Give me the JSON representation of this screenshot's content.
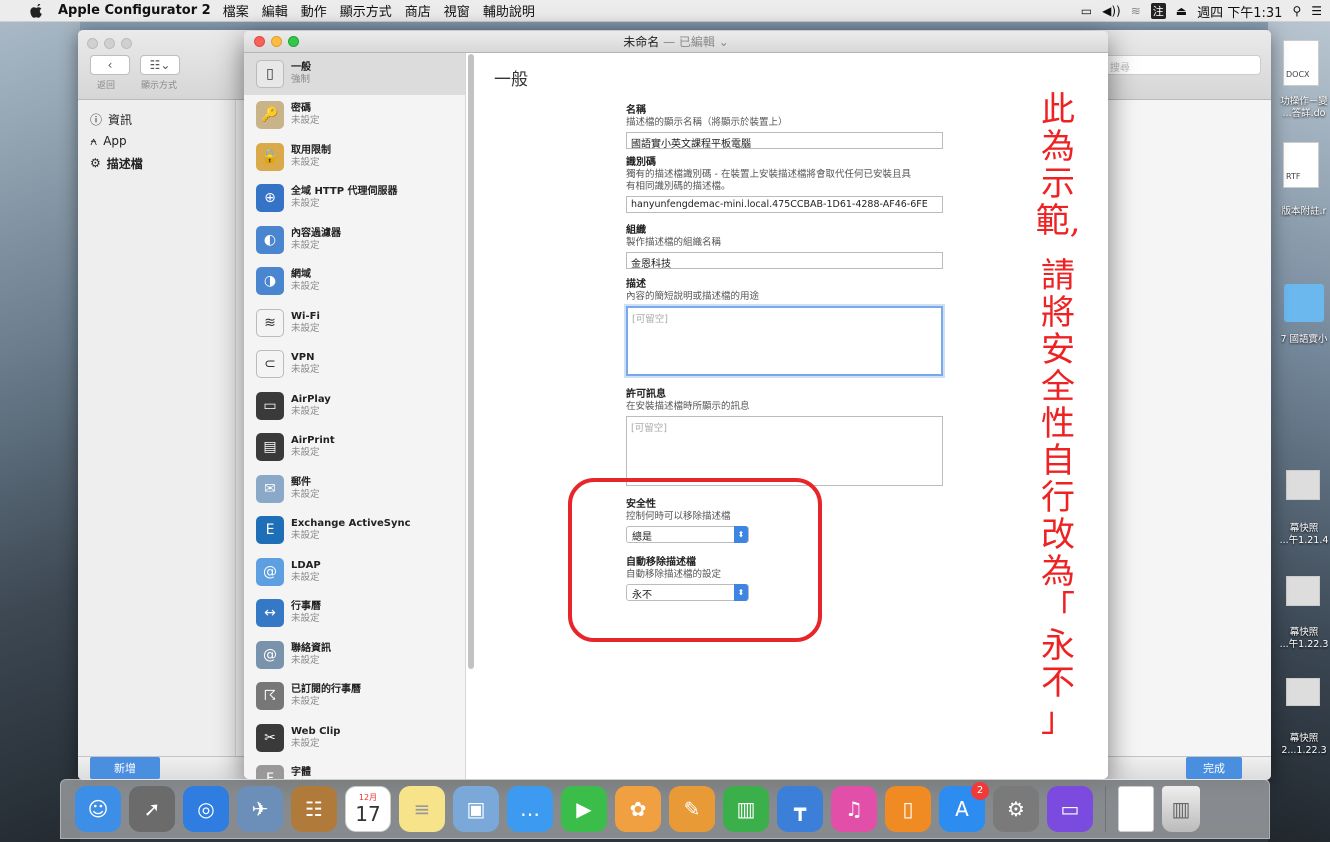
{
  "menubar": {
    "app_name": "Apple Configurator 2",
    "menus": [
      "檔案",
      "編輯",
      "動作",
      "顯示方式",
      "商店",
      "視窗",
      "輔助說明"
    ],
    "datetime": "週四 下午1:31",
    "input_method": "注"
  },
  "bg_window": {
    "back_label": "返回",
    "view_label": "顯示方式",
    "search_placeholder": "搜尋",
    "sidebar": [
      {
        "icon": "info-icon",
        "label": "資訊"
      },
      {
        "icon": "app-icon",
        "label": "App"
      },
      {
        "icon": "gear-icon",
        "label": "描述檔"
      }
    ],
    "add_button": "新增",
    "done_button": "完成"
  },
  "main_window": {
    "title": "未命名",
    "title_status": "— 已編輯 ⌄",
    "payloads": [
      {
        "icon": "general-icon",
        "title": "一般",
        "sub": "強制",
        "bg": "#e8e8e8",
        "glyph": "▯"
      },
      {
        "icon": "key-icon",
        "title": "密碼",
        "sub": "未設定",
        "bg": "#c9b48a",
        "glyph": "🔑"
      },
      {
        "icon": "lock-icon",
        "title": "取用限制",
        "sub": "未設定",
        "bg": "#d9a94a",
        "glyph": "🔒"
      },
      {
        "icon": "global-proxy-icon",
        "title": "全域 HTTP 代理伺服器",
        "sub": "未設定",
        "bg": "#3573c7",
        "glyph": "⊕"
      },
      {
        "icon": "content-filter-icon",
        "title": "內容過濾器",
        "sub": "未設定",
        "bg": "#4a86cf",
        "glyph": "◐"
      },
      {
        "icon": "domains-icon",
        "title": "網域",
        "sub": "未設定",
        "bg": "#4a86cf",
        "glyph": "◑"
      },
      {
        "icon": "wifi-icon",
        "title": "Wi-Fi",
        "sub": "未設定",
        "bg": "#f4f4f4",
        "glyph": "≋"
      },
      {
        "icon": "vpn-icon",
        "title": "VPN",
        "sub": "未設定",
        "bg": "#f4f4f4",
        "glyph": "⊂"
      },
      {
        "icon": "airplay-icon",
        "title": "AirPlay",
        "sub": "未設定",
        "bg": "#3a3a3a",
        "glyph": "▭"
      },
      {
        "icon": "airprint-icon",
        "title": "AirPrint",
        "sub": "未設定",
        "bg": "#3a3a3a",
        "glyph": "▤"
      },
      {
        "icon": "mail-icon",
        "title": "郵件",
        "sub": "未設定",
        "bg": "#8aa9c8",
        "glyph": "✉"
      },
      {
        "icon": "exchange-icon",
        "title": "Exchange ActiveSync",
        "sub": "未設定",
        "bg": "#1f6fb8",
        "glyph": "E"
      },
      {
        "icon": "ldap-icon",
        "title": "LDAP",
        "sub": "未設定",
        "bg": "#5d9fe0",
        "glyph": "@"
      },
      {
        "icon": "calendar-icon",
        "title": "行事曆",
        "sub": "未設定",
        "bg": "#3578c5",
        "glyph": "↔"
      },
      {
        "icon": "contacts-icon",
        "title": "聯絡資訊",
        "sub": "未設定",
        "bg": "#7a93ad",
        "glyph": "@"
      },
      {
        "icon": "subscribed-calendar-icon",
        "title": "已訂閱的行事曆",
        "sub": "未設定",
        "bg": "#777",
        "glyph": "☈"
      },
      {
        "icon": "webclip-icon",
        "title": "Web Clip",
        "sub": "未設定",
        "bg": "#3a3a3a",
        "glyph": "✂"
      },
      {
        "icon": "font-icon",
        "title": "字體",
        "sub": "未設定",
        "bg": "#999",
        "glyph": "F"
      }
    ]
  },
  "form": {
    "section_title": "一般",
    "name": {
      "label": "名稱",
      "desc": "描述檔的顯示名稱（將顯示於裝置上）",
      "value": "國語實小英文課程平板電腦"
    },
    "identifier": {
      "label": "識別碼",
      "desc1": "獨有的描述檔識別碼 - 在裝置上安裝描述檔將會取代任何已安裝且具",
      "desc2": "有相同識別碼的描述檔。",
      "value": "hanyunfengdemac-mini.local.475CCBAB-1D61-4288-AF46-6FE"
    },
    "org": {
      "label": "組織",
      "desc": "製作描述檔的組織名稱",
      "value": "金恩科技"
    },
    "description": {
      "label": "描述",
      "desc": "內容的簡短說明或描述檔的用途",
      "placeholder": "[可留空]"
    },
    "consent": {
      "label": "許可訊息",
      "desc": "在安裝描述檔時所顯示的訊息",
      "placeholder": "[可留空]"
    },
    "security": {
      "label": "安全性",
      "desc": "控制何時可以移除描述檔",
      "value": "總是"
    },
    "auto_remove": {
      "label": "自動移除描述檔",
      "desc": "自動移除描述檔的設定",
      "value": "永不"
    }
  },
  "annotation": {
    "color": "#ee2222",
    "part1": [
      "此",
      "為",
      "示",
      "範,"
    ],
    "part2": [
      "請",
      "將",
      "安",
      "全",
      "性",
      "自",
      "行",
      "改",
      "為",
      "「",
      "永",
      "不",
      "」"
    ]
  },
  "desktop_files": [
    {
      "label": "DOCX",
      "name1": "功操作－變",
      "name2": "...答詳.do"
    },
    {
      "label": "RTF",
      "name1": "版本附註.r",
      "name2": ""
    },
    {
      "label": "",
      "name1": "7 國語實小",
      "name2": ""
    },
    {
      "label": "",
      "name1": "幕快照",
      "name2": "...午1.21.4"
    },
    {
      "label": "",
      "name1": "幕快照",
      "name2": "...午1.22.3"
    },
    {
      "label": "",
      "name1": "幕快照",
      "name2": "2...1.22.3"
    }
  ],
  "dock": {
    "calendar_month": "12月",
    "calendar_day": "17",
    "appstore_badge": "2",
    "apps": [
      {
        "icon": "finder-icon",
        "bg": "#3d8ee6",
        "glyph": "☺"
      },
      {
        "icon": "launchpad-icon",
        "bg": "#6b6b6b",
        "glyph": "➚"
      },
      {
        "icon": "safari-icon",
        "bg": "#2f7de0",
        "glyph": "◎"
      },
      {
        "icon": "preview-icon",
        "bg": "#6b8fb8",
        "glyph": "✈"
      },
      {
        "icon": "contacts-app-icon",
        "bg": "#b07a3a",
        "glyph": "☷"
      },
      {
        "icon": "calendar-app-icon",
        "bg": "#ffffff",
        "glyph": ""
      },
      {
        "icon": "notes-icon",
        "bg": "#f7e48a",
        "glyph": "≡"
      },
      {
        "icon": "preview2-icon",
        "bg": "#7aa8d8",
        "glyph": "▣"
      },
      {
        "icon": "messages-icon",
        "bg": "#3c9bf0",
        "glyph": "…"
      },
      {
        "icon": "facetime-icon",
        "bg": "#3bbd4a",
        "glyph": "▶"
      },
      {
        "icon": "photos-icon",
        "bg": "#f0a040",
        "glyph": "✿"
      },
      {
        "icon": "pages-icon",
        "bg": "#e89a36",
        "glyph": "✎"
      },
      {
        "icon": "numbers-icon",
        "bg": "#3bb04a",
        "glyph": "▥"
      },
      {
        "icon": "keynote-icon",
        "bg": "#3b7fd8",
        "glyph": "┳"
      },
      {
        "icon": "itunes-icon",
        "bg": "#e14fa8",
        "glyph": "♫"
      },
      {
        "icon": "ibooks-icon",
        "bg": "#f08a22",
        "glyph": "▯"
      },
      {
        "icon": "appstore-icon",
        "bg": "#2d8cf0",
        "glyph": "A"
      },
      {
        "icon": "system-preferences-icon",
        "bg": "#7a7a7a",
        "glyph": "⚙"
      },
      {
        "icon": "configurator-icon",
        "bg": "#7b4be0",
        "glyph": "▭"
      }
    ]
  }
}
